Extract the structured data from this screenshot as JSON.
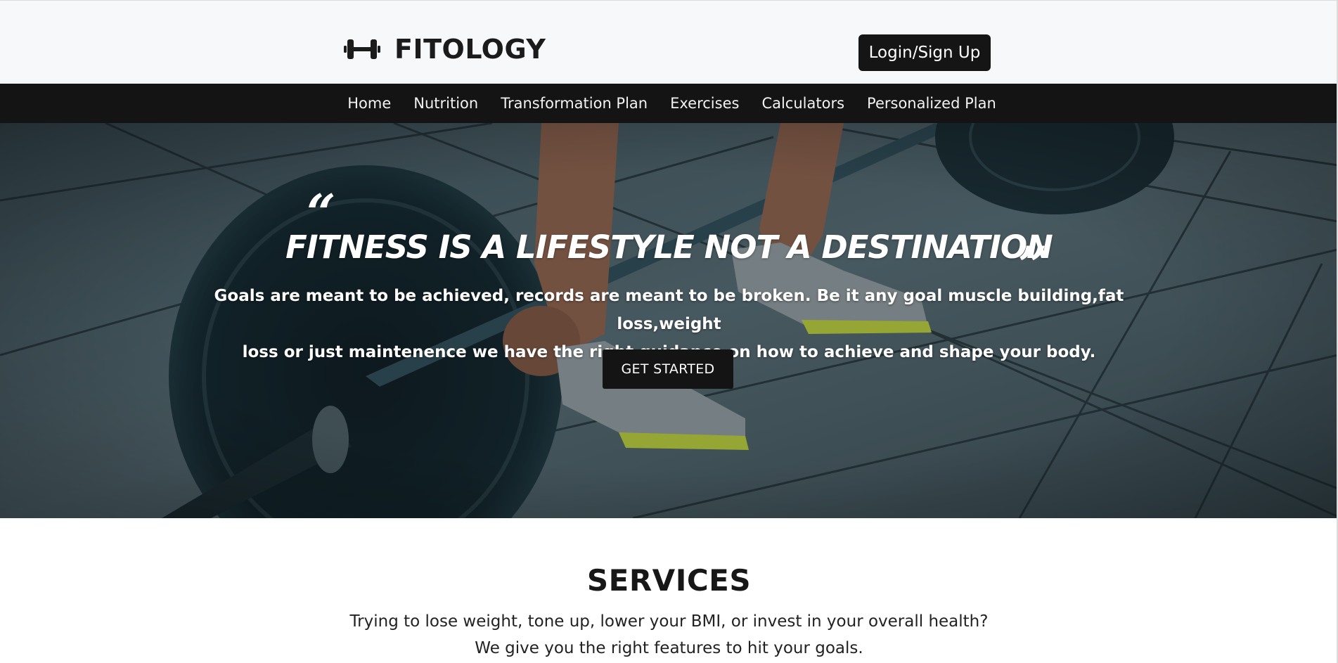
{
  "header": {
    "brand_name": "FITOLOGY",
    "brand_icon": "dumbbell-icon",
    "login_label": "Login/Sign Up"
  },
  "nav": {
    "items": [
      {
        "label": "Home"
      },
      {
        "label": "Nutrition"
      },
      {
        "label": "Transformation Plan"
      },
      {
        "label": "Exercises"
      },
      {
        "label": "Calculators"
      },
      {
        "label": "Personalized Plan"
      }
    ]
  },
  "hero": {
    "quote_open": "“",
    "title": "FITNESS IS A LIFESTYLE NOT A DESTINATION",
    "quote_close": "”",
    "line1": "Goals are meant to be achieved, records are meant to be broken. Be it any goal muscle building,fat loss,weight",
    "line2": "loss or just maintenence we have the right guidance on how to achieve and shape your body.",
    "cta_label": "GET STARTED"
  },
  "services": {
    "title": "SERVICES",
    "line1": "Trying to lose weight, tone up, lower your BMI, or invest in your overall health?",
    "line2": "We give you the right features to hit your goals."
  },
  "colors": {
    "header_bg": "#f7f8fa",
    "nav_bg": "#141414",
    "button_bg": "#151515",
    "text_light": "#ffffff",
    "accent_shoe": "#b5c63a"
  }
}
